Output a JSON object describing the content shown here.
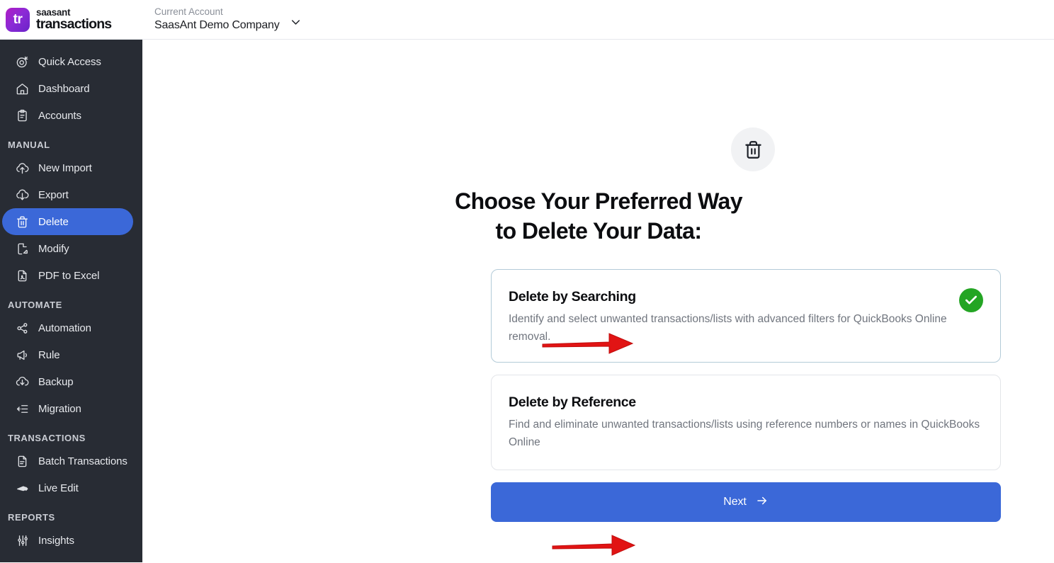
{
  "topbar": {
    "logo_mark": "tr",
    "brand_line1": "saasant",
    "brand_line2": "transactions",
    "account_label": "Current Account",
    "account_name": "SaasAnt Demo Company",
    "chevron_icon": "chevron-down-icon"
  },
  "sidebar": {
    "groups": [
      {
        "section": null,
        "items": [
          {
            "label": "Quick Access",
            "icon": "target-icon",
            "active": false
          },
          {
            "label": "Dashboard",
            "icon": "home-icon",
            "active": false
          },
          {
            "label": "Accounts",
            "icon": "clipboard-icon",
            "active": false
          }
        ]
      },
      {
        "section": "MANUAL",
        "items": [
          {
            "label": "New Import",
            "icon": "cloud-upload-icon",
            "active": false
          },
          {
            "label": "Export",
            "icon": "cloud-download-icon",
            "active": false
          },
          {
            "label": "Delete",
            "icon": "trash-icon",
            "active": true
          },
          {
            "label": "Modify",
            "icon": "file-edit-icon",
            "active": false
          },
          {
            "label": "PDF to Excel",
            "icon": "pdf-file-icon",
            "active": false
          }
        ]
      },
      {
        "section": "AUTOMATE",
        "items": [
          {
            "label": "Automation",
            "icon": "share-nodes-icon",
            "active": false
          },
          {
            "label": "Rule",
            "icon": "megaphone-icon",
            "active": false
          },
          {
            "label": "Backup",
            "icon": "cloud-backup-icon",
            "active": false
          },
          {
            "label": "Migration",
            "icon": "migration-icon",
            "active": false
          }
        ]
      },
      {
        "section": "TRANSACTIONS",
        "items": [
          {
            "label": "Batch Transactions",
            "icon": "document-icon",
            "active": false
          },
          {
            "label": "Live Edit",
            "icon": "pencil-tag-icon",
            "active": false
          }
        ]
      },
      {
        "section": "REPORTS",
        "items": [
          {
            "label": "Insights",
            "icon": "sliders-icon",
            "active": false
          }
        ]
      }
    ]
  },
  "main": {
    "hero_icon": "trash-icon",
    "heading_line1": "Choose Your Preferred Way",
    "heading_line2": "to Delete Your Data:",
    "options": [
      {
        "title": "Delete by Searching",
        "description": "Identify and select unwanted transactions/lists with advanced filters for QuickBooks Online removal.",
        "selected": true,
        "badge_icon": "check-circle-icon"
      },
      {
        "title": "Delete by Reference",
        "description": "Find and eliminate unwanted transactions/lists using reference numbers or names in QuickBooks Online",
        "selected": false,
        "badge_icon": null
      }
    ],
    "next_label": "Next",
    "next_icon": "arrow-right-icon"
  },
  "annotations": [
    {
      "name": "arrow-to-delete-by-searching",
      "icon": "red-arrow-right"
    },
    {
      "name": "arrow-to-next-button",
      "icon": "red-arrow-right"
    }
  ],
  "colors": {
    "sidebar_bg": "#282c34",
    "accent_blue": "#3b68d8",
    "selected_border": "#b3cbd8",
    "success_green": "#24a524",
    "annotation_red": "#e11414"
  }
}
